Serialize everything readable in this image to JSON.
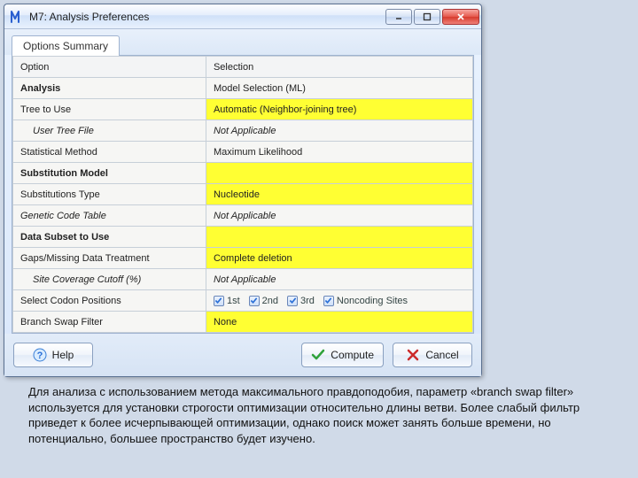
{
  "window": {
    "title": "M7: Analysis Preferences"
  },
  "tabstrip": {
    "tab1": "Options Summary"
  },
  "headers": {
    "option": "Option",
    "selection": "Selection"
  },
  "rows": {
    "analysis": {
      "label": "Analysis",
      "value": "Model Selection (ML)"
    },
    "tree_to_use": {
      "label": "Tree to Use",
      "value": "Automatic (Neighbor-joining tree)"
    },
    "user_tree_file": {
      "label": "User Tree File",
      "value": "Not Applicable"
    },
    "stat_method": {
      "label": "Statistical Method",
      "value": "Maximum Likelihood"
    },
    "sub_model_header": {
      "label": "Substitution Model"
    },
    "sub_type": {
      "label": "Substitutions Type",
      "value": "Nucleotide"
    },
    "genetic_code": {
      "label": "Genetic Code Table",
      "value": "Not Applicable"
    },
    "data_subset_header": {
      "label": "Data Subset to Use"
    },
    "gaps": {
      "label": "Gaps/Missing Data Treatment",
      "value": "Complete deletion"
    },
    "site_cov": {
      "label": "Site Coverage Cutoff (%)",
      "value": "Not Applicable"
    },
    "codon": {
      "label": "Select Codon Positions",
      "p1": "1st",
      "p2": "2nd",
      "p3": "3rd",
      "p4": "Noncoding Sites"
    },
    "branch_swap": {
      "label": "Branch Swap Filter",
      "value": "None"
    }
  },
  "buttons": {
    "help": "Help",
    "compute": "Compute",
    "cancel": "Cancel"
  },
  "caption": "Для анализа с использованием метода максимального правдоподобия, параметр «branch swap filter» используется для установки строгости оптимизации относительно длины ветви. Более слабый фильтр приведет к более исчерпывающей оптимизации, однако поиск может занять больше времени, но потенциально, большее пространство будет изучено."
}
